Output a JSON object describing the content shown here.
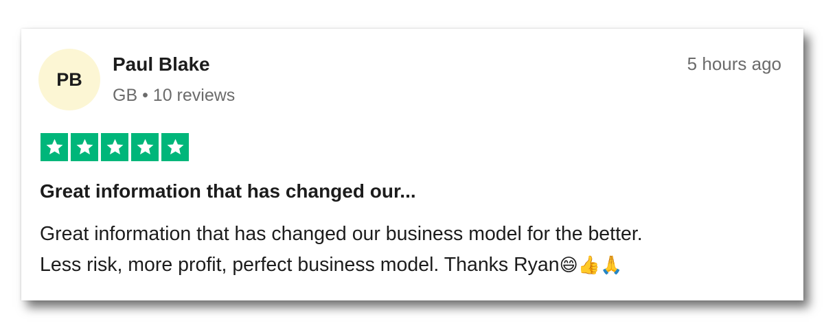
{
  "reviewer": {
    "initials": "PB",
    "name": "Paul Blake",
    "country": "GB",
    "separator": "•",
    "review_count": "10 reviews"
  },
  "timestamp": "5 hours ago",
  "rating": {
    "stars": 5,
    "max": 5,
    "color": "#00b67a"
  },
  "review": {
    "title": "Great information that has changed our...",
    "line1": "Great information that has changed our business model for the better.",
    "line2": "Less risk, more profit, perfect business model. Thanks Ryan",
    "emojis": "😄👍🙏"
  },
  "colors": {
    "avatar_bg": "#fcf6d4",
    "text": "#1c1c1c",
    "muted": "#6b6b6b"
  }
}
